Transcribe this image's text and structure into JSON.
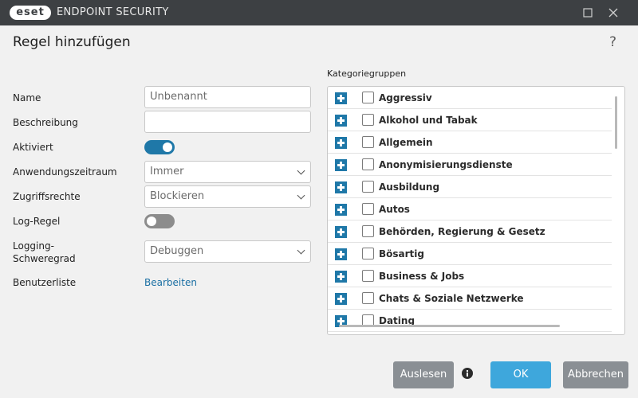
{
  "window": {
    "logo_text": "eset",
    "app_title": "ENDPOINT SECURITY"
  },
  "dialog": {
    "title": "Regel hinzufügen",
    "help": "?"
  },
  "form": {
    "name_label": "Name",
    "name_value": "Unbenannt",
    "description_label": "Beschreibung",
    "description_value": "",
    "enabled_label": "Aktiviert",
    "enabled": true,
    "timeframe_label": "Anwendungszeitraum",
    "timeframe_value": "Immer",
    "access_label": "Zugriffsrechte",
    "access_value": "Blockieren",
    "log_rule_label": "Log-Regel",
    "log_rule": false,
    "logging_label_1": "Logging-",
    "logging_label_2": "Schweregrad",
    "logging_value": "Debuggen",
    "userlist_label": "Benutzerliste",
    "userlist_link": "Bearbeiten"
  },
  "categories": {
    "label": "Kategoriegruppen",
    "items": [
      "Aggressiv",
      "Alkohol und Tabak",
      "Allgemein",
      "Anonymisierungsdienste",
      "Ausbildung",
      "Autos",
      "Behörden, Regierung & Gesetz",
      "Bösartig",
      "Business & Jobs",
      "Chats & Soziale Netzwerke",
      "Dating"
    ]
  },
  "buttons": {
    "read": "Auslesen",
    "ok": "OK",
    "cancel": "Abbrechen"
  },
  "colors": {
    "accent": "#1f78a8",
    "ok_button": "#3ea7dc",
    "titlebar": "#3d4043"
  }
}
